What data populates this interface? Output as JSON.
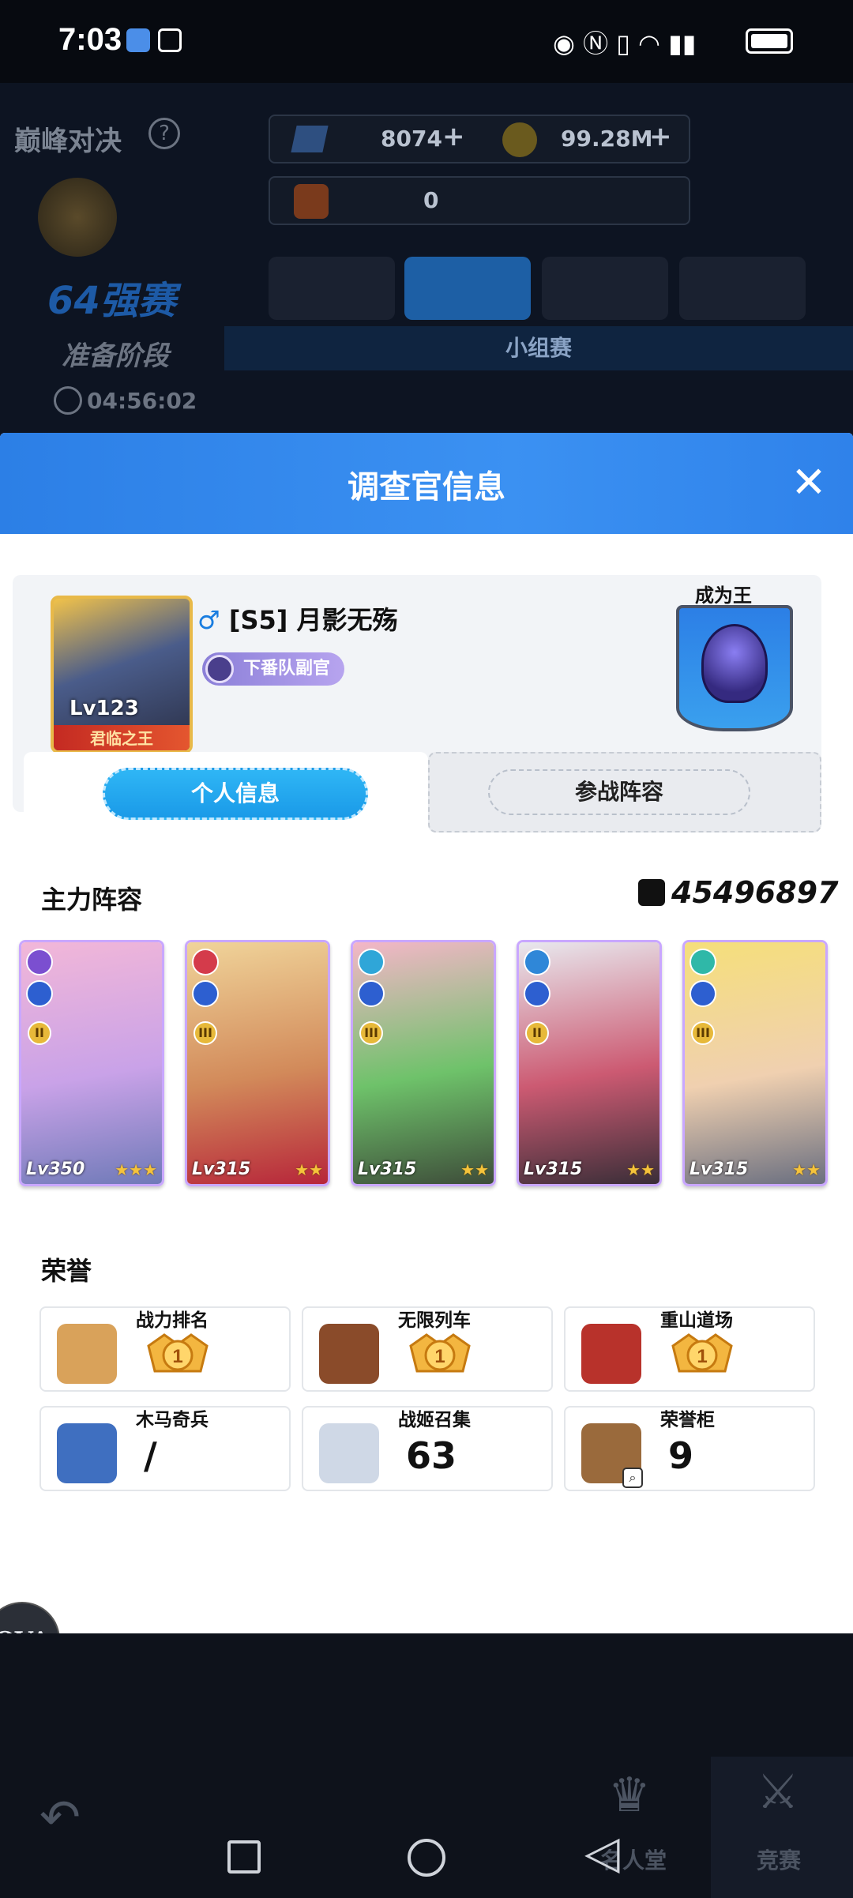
{
  "status_bar": {
    "time": "7:03"
  },
  "background": {
    "mode_title": "巅峰对决",
    "gems": "8074",
    "coins": "99.28M",
    "tickets": "0",
    "stage_title": "64强赛",
    "stage_phase": "准备阶段",
    "countdown": "04:56:02",
    "group_label": "小组赛"
  },
  "modal": {
    "title": "调查官信息",
    "player": {
      "gender_symbol": "♂",
      "name": "[S5] 月影无殇",
      "level": "Lv123",
      "avatar_title": "君临之王",
      "rank_badge": "下番队副官",
      "throne_label": "成为王"
    },
    "tabs": [
      "个人信息",
      "参战阵容"
    ],
    "main_lineup_title": "主力阵容",
    "power": "45496897",
    "cards": [
      {
        "level": "Lv350",
        "tier": "II",
        "stars": "★★★",
        "elem_color": "#7b4fd0",
        "art": [
          "#f2b7d8",
          "#c9a2e8",
          "#6f7ab8"
        ]
      },
      {
        "level": "Lv315",
        "tier": "III",
        "stars": "★★",
        "elem_color": "#d43b4b",
        "art": [
          "#f0d49a",
          "#d28a5a",
          "#b7263a"
        ]
      },
      {
        "level": "Lv315",
        "tier": "III",
        "stars": "★★",
        "elem_color": "#2fa6d8",
        "art": [
          "#f4b6c8",
          "#6ec26a",
          "#3e4d3a"
        ]
      },
      {
        "level": "Lv315",
        "tier": "II",
        "stars": "★★",
        "elem_color": "#2f87d8",
        "art": [
          "#e8e8ee",
          "#cc5a72",
          "#3a2e38"
        ]
      },
      {
        "level": "Lv315",
        "tier": "III",
        "stars": "★★",
        "elem_color": "#2fb8a8",
        "art": [
          "#f5df7a",
          "#f0d0b0",
          "#6a6f80"
        ]
      }
    ],
    "honor_title": "荣誉",
    "honors": [
      {
        "label": "战力排名",
        "value": "1",
        "kind": "medal",
        "icon": "fist-icon"
      },
      {
        "label": "无限列车",
        "value": "1",
        "kind": "medal",
        "icon": "train-icon"
      },
      {
        "label": "重山道场",
        "value": "1",
        "kind": "medal",
        "icon": "drum-icon"
      },
      {
        "label": "木马奇兵",
        "value": "/",
        "kind": "text",
        "icon": "knight-icon"
      },
      {
        "label": "战姬召集",
        "value": "63",
        "kind": "text",
        "icon": "figure-icon"
      },
      {
        "label": "荣誉柜",
        "value": "9",
        "kind": "text",
        "icon": "cabinet-icon"
      }
    ]
  },
  "bottom_nav": {
    "hall": "名人堂",
    "contest": "竞赛",
    "overlay_logo": "OVA"
  }
}
